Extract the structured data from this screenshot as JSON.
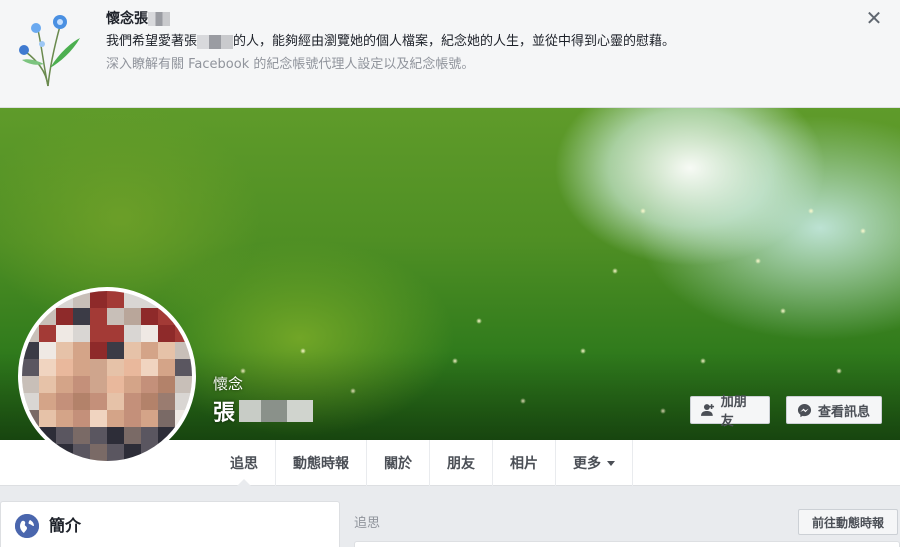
{
  "banner": {
    "title_prefix": "懷念張",
    "message_prefix": "我們希望愛著張",
    "message_suffix": "的人，能夠經由瀏覽她的個人檔案，紀念她的人生，並從中得到心靈的慰藉。",
    "link_prefix": "深入瞭解有關 Facebook 的",
    "link_text": "紀念帳號代理人設定以及紀念帳號",
    "link_suffix": "。",
    "close_glyph": "✕"
  },
  "profile": {
    "memorial_label": "懷念",
    "name_prefix": "張"
  },
  "actions": {
    "add_friend": "加朋友",
    "view_message": "查看訊息"
  },
  "tabs": [
    {
      "label": "追思",
      "active": true
    },
    {
      "label": "動態時報"
    },
    {
      "label": "關於"
    },
    {
      "label": "朋友"
    },
    {
      "label": "相片"
    },
    {
      "label": "更多"
    }
  ],
  "intro": {
    "title": "簡介",
    "icon": "globe-icon"
  },
  "feed": {
    "heading": "追思",
    "go_timeline": "前往動態時報"
  },
  "colors": {
    "link": "#4267b2",
    "accent": "#4a66ad",
    "cover_green": "#4f8f24"
  }
}
